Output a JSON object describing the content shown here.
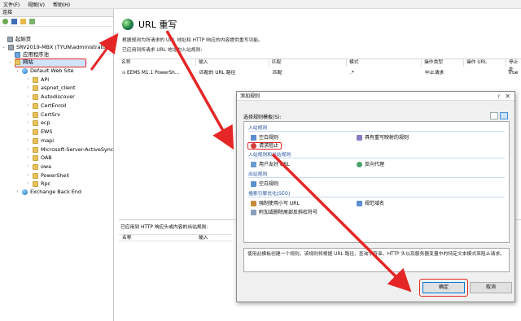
{
  "menu": [
    "文件(F)",
    "视图(V)",
    "帮助(H)"
  ],
  "connections": {
    "title": "连接",
    "tree": {
      "start_page": "起始页",
      "server": "SRV2019-MBX (TYUN\\administrator)",
      "app_pools": "应用程序池",
      "sites": "网站",
      "default_site": "Default Web Site",
      "children": [
        "API",
        "aspnet_client",
        "Autodiscover",
        "CertEnroll",
        "CertSrv",
        "ecp",
        "EWS",
        "mapi",
        "Microsoft-Server-ActiveSync",
        "OAB",
        "owa",
        "PowerShell",
        "Rpc"
      ],
      "backend": "Exchange Back End"
    }
  },
  "main": {
    "title": "URL 重写",
    "description": "根据规则为所请求的 URL 地址和 HTTP 响应的内容提供重写功能。",
    "applied_label": "已应用到所请求 URL 地址的入站规则:",
    "columns": [
      "名称",
      "输入",
      "匹配",
      "模式",
      "操作类型",
      "操作 URL",
      "停止处"
    ],
    "row": {
      "name": "EEMS M1.1 PowerSh...",
      "input": "匹配的 URL 路径",
      "match": "匹配",
      "pattern": ".*",
      "action": "中止请求",
      "url": "",
      "stop": "True"
    },
    "outbound_label": "已应用到 HTTP 响应头或内容的出站规则:",
    "outbound_columns": [
      "名称",
      "输入"
    ]
  },
  "dialog": {
    "title": "添加规则",
    "help": "?",
    "close": "✕",
    "template_label": "选择规则模板(S):",
    "groups": {
      "inbound": "入站规则",
      "in_out": "入站规则和出站规则",
      "outbound": "出站规则",
      "seo": "搜索引擎优化(SEO)"
    },
    "items": {
      "blank_rule": "空白规则",
      "rewrite_map_rule": "具有重写映射的规则",
      "request_blocking": "请求阻止",
      "friendly_url": "用户友好 URL",
      "reverse_proxy": "反向代理",
      "blank_rule_out": "空白规则",
      "lowercase": "强制使用小写 URL",
      "canonical_domain": "规范域名",
      "trailing_slash": "附加或删除尾部反斜杠符号"
    },
    "description": "使用此模板创建一个规则，该规则将根据 URL 路径、查询字符串、HTTP 头以及服务器变量中的特定文本模式来阻止请求。",
    "ok": "确定",
    "cancel": "取消"
  },
  "colors": {
    "annotation_red": "#e52626",
    "group_blue": "#1e4e9c"
  }
}
